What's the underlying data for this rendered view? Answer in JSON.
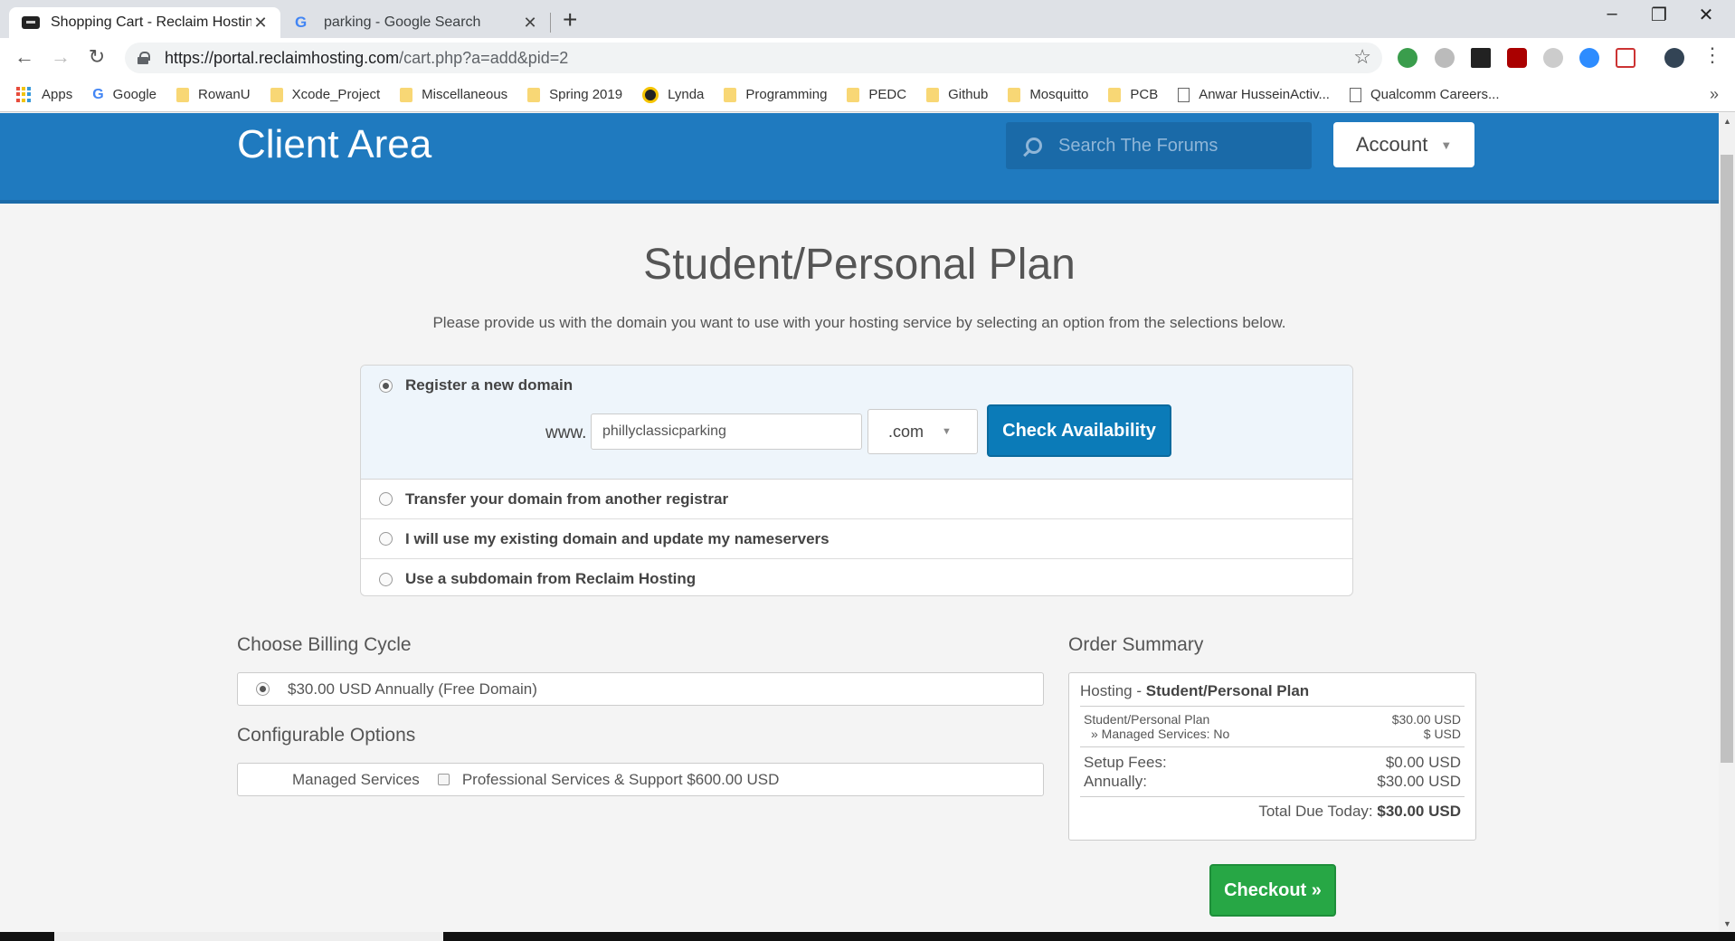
{
  "browser": {
    "tabs": [
      {
        "title": "Shopping Cart - Reclaim Hosting",
        "active": true
      },
      {
        "title": "parking - Google Search",
        "active": false
      }
    ],
    "url_host": "https://portal.reclaimhosting.com",
    "url_path": "/cart.php?a=add&pid=2",
    "bookmarks": [
      "Apps",
      "Google",
      "RowanU",
      "Xcode_Project",
      "Miscellaneous",
      "Spring 2019",
      "Lynda",
      "Programming",
      "PEDC",
      "Github",
      "Mosquitto",
      "PCB",
      "Anwar HusseinActiv...",
      "Qualcomm Careers..."
    ],
    "more_bookmarks": "»"
  },
  "header": {
    "brand": "Client Area",
    "search_placeholder": "Search The Forums",
    "account_label": "Account"
  },
  "page": {
    "title": "Student/Personal Plan",
    "description": "Please provide us with the domain you want to use with your hosting service by selecting an option from the selections below."
  },
  "domain": {
    "options": [
      "Register a new domain",
      "Transfer your domain from another registrar",
      "I will use my existing domain and update my nameservers",
      "Use a subdomain from Reclaim Hosting"
    ],
    "selected_index": 0,
    "www_label": "www.",
    "input_value": "phillyclassicparking",
    "tld": ".com",
    "check_button": "Check Availability"
  },
  "billing": {
    "heading": "Choose Billing Cycle",
    "option": "$30.00 USD Annually (Free Domain)"
  },
  "config": {
    "heading": "Configurable Options",
    "label": "Managed Services",
    "option": "Professional Services & Support $600.00 USD"
  },
  "summary": {
    "heading": "Order Summary",
    "title_prefix": "Hosting - ",
    "title_plan": "Student/Personal Plan",
    "line1_left": "Student/Personal Plan",
    "line2_left": "» Managed Services: No",
    "line1_right": "$30.00 USD",
    "line2_right": "$ USD",
    "setup_label": "Setup Fees:",
    "setup_value": "$0.00 USD",
    "annual_label": "Annually:",
    "annual_value": "$30.00 USD",
    "total_label": "Total Due Today:",
    "total_value": "$30.00 USD"
  },
  "checkout_label": "Checkout »",
  "colors": {
    "header_blue": "#1f7abf",
    "button_blue": "#0b7bb8",
    "checkout_green": "#27a745"
  }
}
